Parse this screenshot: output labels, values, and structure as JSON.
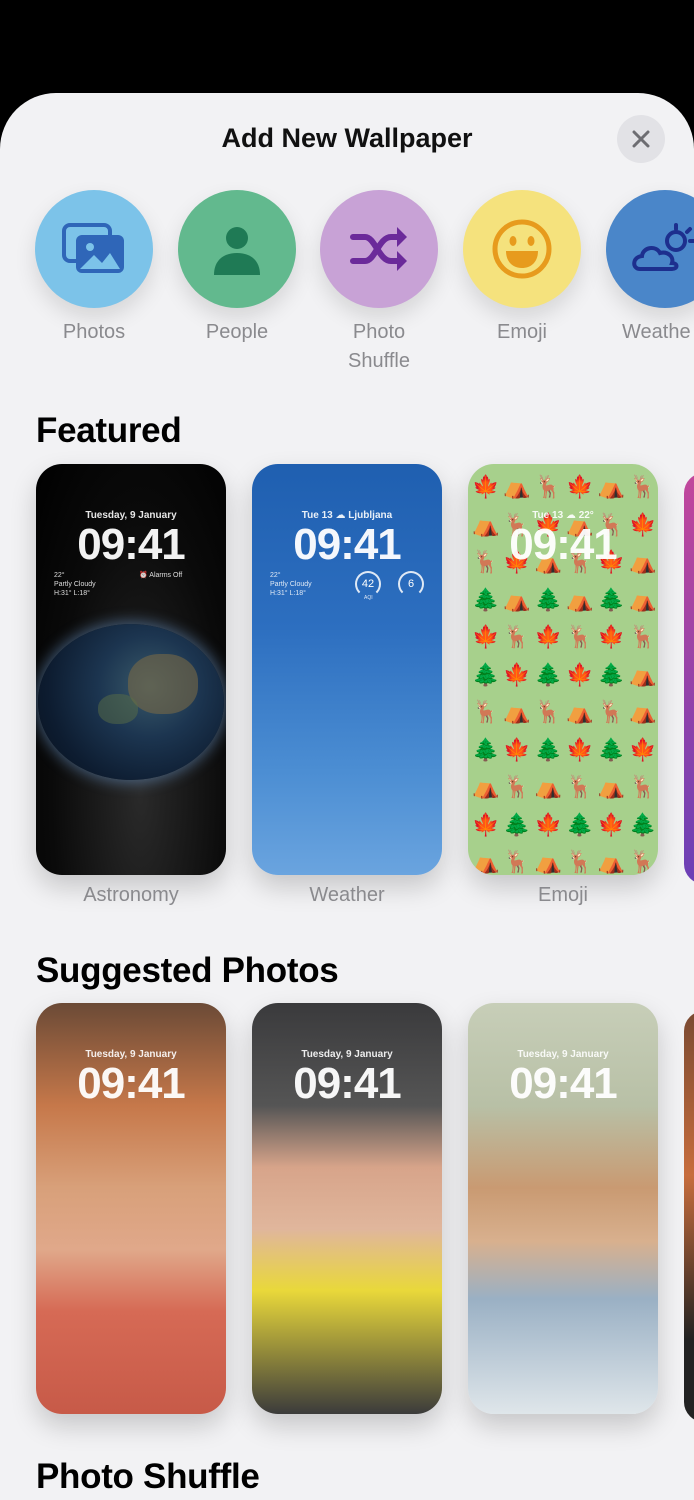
{
  "sheet": {
    "title": "Add New Wallpaper"
  },
  "types": [
    {
      "label": "Photos",
      "color": "#7cc3e9",
      "icon": "photos-icon"
    },
    {
      "label": "People",
      "color": "#62b98e",
      "icon": "person-icon"
    },
    {
      "label": "Photo\nShuffle",
      "color": "#c8a2d6",
      "icon": "shuffle-icon"
    },
    {
      "label": "Emoji",
      "color": "#f5e27d",
      "icon": "smiley-icon"
    },
    {
      "label": "Weathe",
      "color": "#4a86c9",
      "icon": "weather-cloud-sun-icon"
    }
  ],
  "featured": {
    "heading": "Featured",
    "cards": [
      {
        "label": "Astronomy",
        "date": "Tuesday, 9 January",
        "time": "09:41",
        "temp": "22°",
        "cond": "Partly Cloudy",
        "hilo": "H:31° L:18°",
        "alarm": "Alarms Off"
      },
      {
        "label": "Weather",
        "date": "Tue 13",
        "location": "Ljubljana",
        "time": "09:41",
        "temp": "22°",
        "cond": "Partly Cloudy",
        "hilo": "H:31° L:18°",
        "aqi": "42",
        "aqi_label": "AQI",
        "uv": "6"
      },
      {
        "label": "Emoji",
        "date": "Tue 13",
        "temp": "22°",
        "time": "09:41"
      }
    ]
  },
  "suggested": {
    "heading": "Suggested Photos",
    "cards": [
      {
        "date": "Tuesday, 9 January",
        "time": "09:41"
      },
      {
        "date": "Tuesday, 9 January",
        "time": "09:41"
      },
      {
        "date": "Tuesday, 9 January",
        "time": "09:41"
      }
    ]
  },
  "shuffle": {
    "heading": "Photo Shuffle"
  }
}
